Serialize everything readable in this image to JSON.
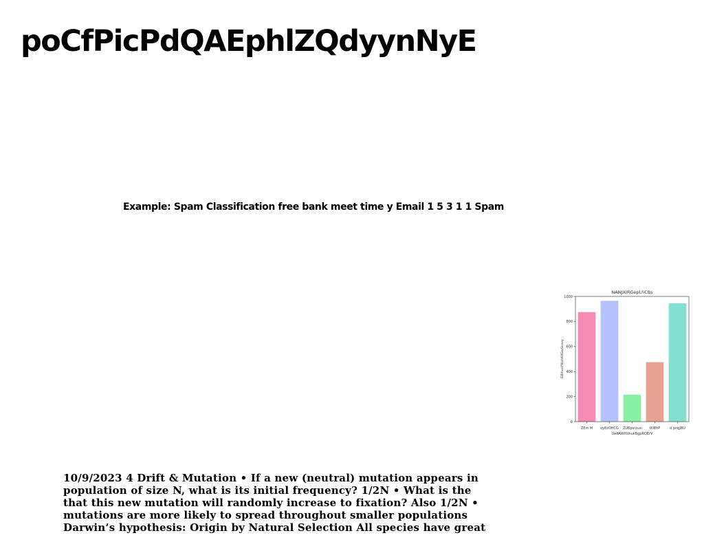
{
  "page": {
    "title": "poCfPicPdQAEphlZQdyynNyE",
    "caption": "Example: Spam Classification free bank meet time y Email 1 5 3 1 1 Spam",
    "body_lines": [
      "10/9/2023 4 Drift & Mutation • If a new (neutral) mutation appears in",
      "population of size N, what is its initial frequency? 1/2N • What is the",
      "that this new mutation will randomly increase to fixation? Also 1/2N •",
      "mutations are more likely to spread throughout smaller populations",
      "Darwin’s hypothesis: Origin by Natural Selection All species have great"
    ]
  },
  "chart_data": {
    "type": "bar",
    "title": "NANJXIRGepLhCBs",
    "xlabel": "UxdAWXUhukBgpRQErV",
    "ylabel": "lEBIhuvYWxHKXGwGsaxy",
    "categories": [
      "ZEm M",
      "oyEzOHCG",
      "ZUBpsrzux",
      "iXIEhP",
      "d pnqJBU"
    ],
    "values": [
      875,
      965,
      215,
      475,
      945
    ],
    "colors": [
      "#f78ab6",
      "#b5c2fb",
      "#86f0a3",
      "#e8a291",
      "#82e0d2"
    ],
    "ylim": [
      0,
      1000
    ],
    "yticks": [
      0,
      200,
      400,
      600,
      800,
      1000
    ],
    "grid": false,
    "legend": "none"
  }
}
